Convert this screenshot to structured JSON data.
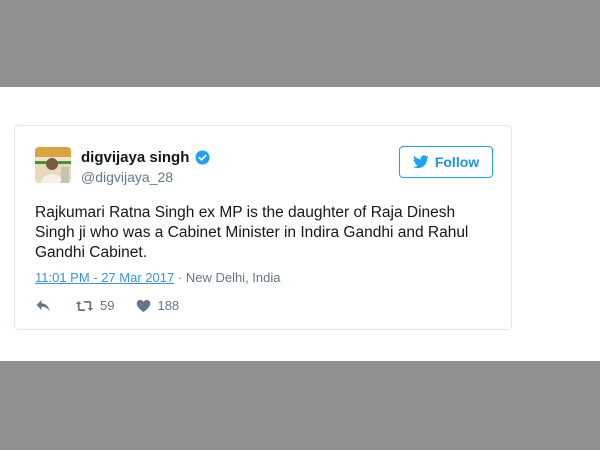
{
  "tweet": {
    "display_name": "digvijaya singh",
    "handle": "@digvijaya_28",
    "text": "Rajkumari Ratna Singh ex MP is the daughter of Raja Dinesh Singh ji who was a Cabinet Minister in Indira Gandhi and Rahul Gandhi Cabinet.",
    "timestamp": "11:01 PM - 27 Mar 2017",
    "separator": "·",
    "location": "New Delhi, India",
    "retweet_count": "59",
    "like_count": "188"
  },
  "follow_button": {
    "label": "Follow"
  },
  "icons": {
    "verified": "verified-badge-icon",
    "follow": "twitter-bird-icon",
    "reply": "reply-arrow-icon",
    "retweet": "retweet-icon",
    "like": "heart-icon"
  },
  "colors": {
    "accent": "#1da1f2",
    "link": "#3b94d9",
    "muted": "#657786",
    "text": "#14171a",
    "background_band": "#8f8f8f"
  }
}
